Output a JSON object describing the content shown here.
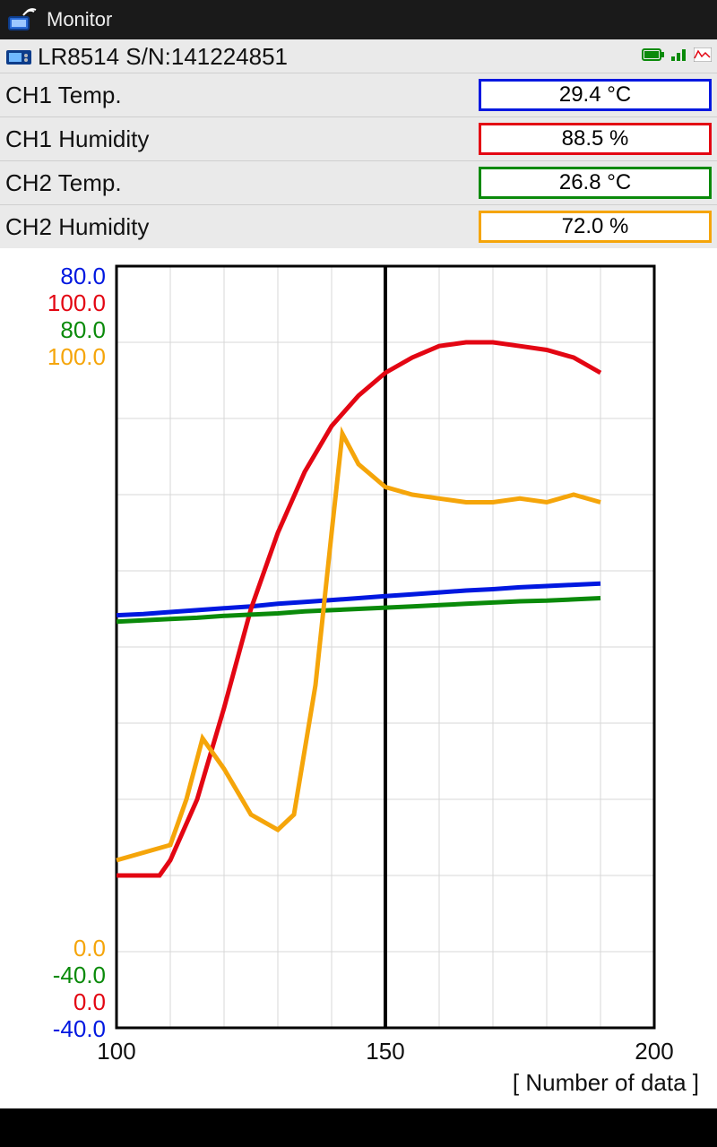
{
  "app": {
    "title": "Monitor"
  },
  "device": {
    "label": "LR8514 S/N:141224851"
  },
  "channels": [
    {
      "label": "CH1 Temp.",
      "value": "29.4 °C",
      "color": "blue"
    },
    {
      "label": "CH1 Humidity",
      "value": "88.5 %",
      "color": "red"
    },
    {
      "label": "CH2 Temp.",
      "value": "26.8 °C",
      "color": "green"
    },
    {
      "label": "CH2 Humidity",
      "value": "72.0 %",
      "color": "orange"
    }
  ],
  "axis": {
    "top_labels": {
      "blue": "80.0",
      "red": "100.0",
      "green": "80.0",
      "orange": "100.0"
    },
    "bottom_labels": {
      "orange": "0.0",
      "green": "-40.0",
      "red": "0.0",
      "blue": "-40.0"
    },
    "x_ticks": {
      "t100": "100",
      "t150": "150",
      "t200": "200"
    },
    "x_title": "[ Number of data ]"
  },
  "chart_data": {
    "type": "line",
    "xlabel": "Number of data",
    "x_range": [
      100,
      200
    ],
    "cursor_x": 150,
    "series": [
      {
        "name": "CH1 Temp.",
        "color": "blue",
        "y_range": [
          -40,
          80
        ],
        "unit": "°C",
        "x": [
          100,
          105,
          110,
          115,
          120,
          125,
          130,
          135,
          140,
          145,
          150,
          155,
          160,
          165,
          170,
          175,
          180,
          185,
          190
        ],
        "y": [
          25.0,
          25.2,
          25.5,
          25.8,
          26.1,
          26.4,
          26.8,
          27.1,
          27.4,
          27.7,
          28.0,
          28.3,
          28.6,
          28.9,
          29.1,
          29.4,
          29.6,
          29.8,
          30.0
        ]
      },
      {
        "name": "CH1 Humidity",
        "color": "red",
        "y_range": [
          0,
          100
        ],
        "unit": "%",
        "x": [
          100,
          105,
          108,
          110,
          115,
          120,
          125,
          130,
          135,
          140,
          145,
          150,
          155,
          160,
          165,
          170,
          175,
          180,
          185,
          190
        ],
        "y": [
          20,
          20,
          20,
          22,
          30,
          42,
          55,
          65,
          73,
          79,
          83,
          86,
          88,
          89.5,
          90,
          90,
          89.5,
          89,
          88,
          86
        ]
      },
      {
        "name": "CH2 Temp.",
        "color": "green",
        "y_range": [
          -40,
          80
        ],
        "unit": "°C",
        "x": [
          100,
          105,
          110,
          115,
          120,
          125,
          130,
          135,
          140,
          145,
          150,
          155,
          160,
          165,
          170,
          175,
          180,
          185,
          190
        ],
        "y": [
          24.0,
          24.2,
          24.4,
          24.6,
          24.9,
          25.1,
          25.3,
          25.6,
          25.8,
          26.0,
          26.2,
          26.4,
          26.6,
          26.8,
          27.0,
          27.2,
          27.3,
          27.5,
          27.7
        ]
      },
      {
        "name": "CH2 Humidity",
        "color": "orange",
        "y_range": [
          0,
          100
        ],
        "unit": "%",
        "x": [
          100,
          105,
          110,
          113,
          116,
          120,
          125,
          130,
          133,
          137,
          140,
          142,
          145,
          150,
          155,
          160,
          165,
          170,
          175,
          180,
          185,
          190
        ],
        "y": [
          22,
          23,
          24,
          30,
          38,
          34,
          28,
          26,
          28,
          45,
          65,
          78,
          74,
          71,
          70,
          69.5,
          69,
          69,
          69.5,
          69,
          70,
          69
        ]
      }
    ]
  }
}
